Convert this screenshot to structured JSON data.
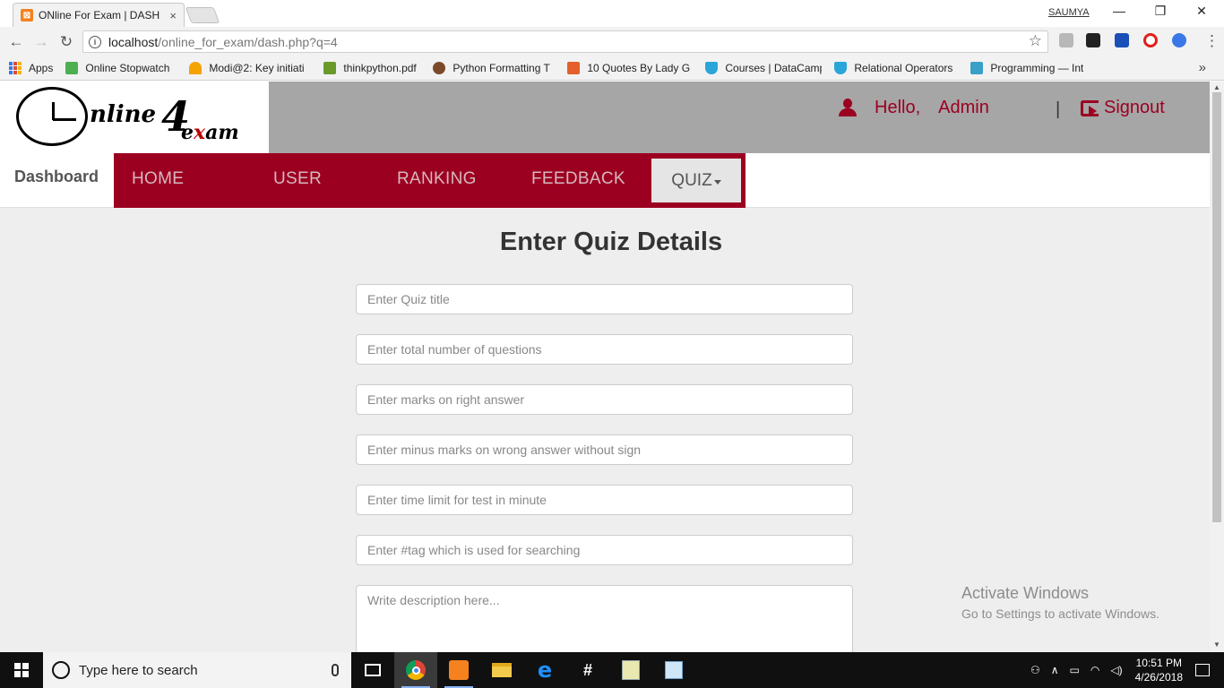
{
  "browser": {
    "tab_title": "ONline For Exam | DASHE",
    "tab_close": "×",
    "profile_name": "SAUMYA",
    "url_host": "localhost",
    "url_path": "/online_for_exam/dash.php?q=4",
    "bookmarks": [
      {
        "label": "Apps",
        "icon": "apps-grid-icon",
        "color": "#3b78e7"
      },
      {
        "label": "Online Stopwatch",
        "icon": "stopwatch-icon",
        "color": "#4caf50"
      },
      {
        "label": "Modi@2: Key initiati",
        "icon": "rainbow-icon",
        "color": "#f4a300"
      },
      {
        "label": "thinkpython.pdf",
        "icon": "leaf-icon",
        "color": "#6a9a2a"
      },
      {
        "label": "Python Formatting T",
        "icon": "dog-icon",
        "color": "#7b4a2a"
      },
      {
        "label": "10 Quotes By Lady G",
        "icon": "s-icon",
        "color": "#e45f2b"
      },
      {
        "label": "Courses | DataCamp",
        "icon": "shield-icon",
        "color": "#2aa5d8"
      },
      {
        "label": "Relational Operators",
        "icon": "shield-icon",
        "color": "#2aa5d8"
      },
      {
        "label": "Programming — Inte",
        "icon": "beta-icon",
        "color": "#3aa0c8"
      }
    ],
    "more_bookmarks": "»"
  },
  "site": {
    "logo_text": "nline",
    "logo_four": "4",
    "logo_exam_e": "e",
    "logo_exam_x": "x",
    "logo_exam_rest": "am",
    "hello": "Hello,",
    "username": "Admin",
    "separator": "|",
    "signout": "Signout",
    "brand": "Dashboard",
    "nav": {
      "home": "HOME",
      "user": "USER",
      "ranking": "RANKING",
      "feedback": "FEEDBACK",
      "quiz": "QUIZ"
    },
    "accent_color": "#9c0021"
  },
  "form": {
    "title": "Enter Quiz Details",
    "fields": {
      "title_placeholder": "Enter Quiz title",
      "total_placeholder": "Enter total number of questions",
      "right_placeholder": "Enter marks on right answer",
      "wrong_placeholder": "Enter minus marks on wrong answer without sign",
      "time_placeholder": "Enter time limit for test in minute",
      "tag_placeholder": "Enter #tag which is used for searching",
      "desc_placeholder": "Write description here..."
    }
  },
  "watermark": {
    "line1": "Activate Windows",
    "line2": "Go to Settings to activate Windows."
  },
  "taskbar": {
    "search_placeholder": "Type here to search",
    "time": "10:51 PM",
    "date": "4/26/2018"
  }
}
